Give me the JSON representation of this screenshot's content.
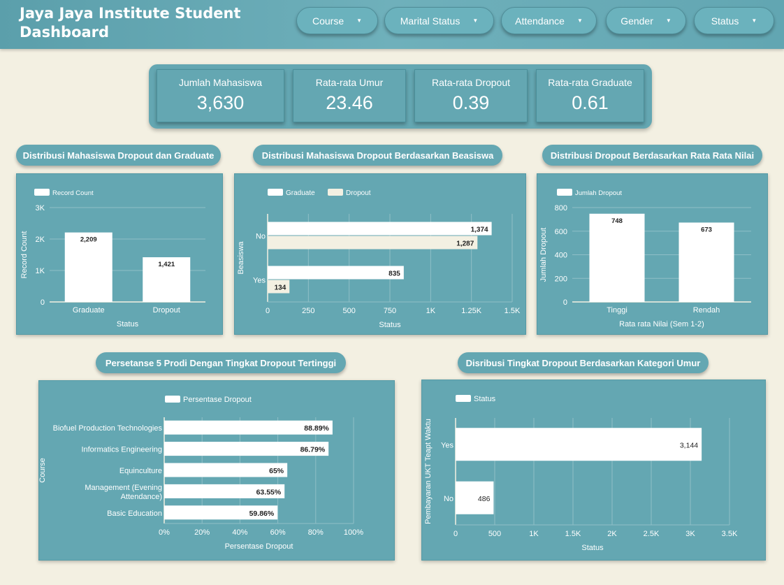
{
  "header": {
    "title": "Jaya Jaya Institute Student Dashboard"
  },
  "filters": [
    {
      "label": "Course"
    },
    {
      "label": "Marital Status"
    },
    {
      "label": "Attendance"
    },
    {
      "label": "Gender"
    },
    {
      "label": "Status"
    }
  ],
  "kpis": [
    {
      "label": "Jumlah Mahasiswa",
      "value": "3,630"
    },
    {
      "label": "Rata-rata Umur",
      "value": "23.46"
    },
    {
      "label": "Rata-rata Dropout",
      "value": "0.39"
    },
    {
      "label": "Rata-rata Graduate",
      "value": "0.61"
    }
  ],
  "colors": {
    "panel": "#64a7b2",
    "bar": "#ffffff",
    "bar_alt": "#f3f0e2",
    "background": "#f3f0e2"
  },
  "chart_data": [
    {
      "type": "bar",
      "title": "Distribusi Mahasiswa Dropout dan Graduate",
      "series": [
        {
          "name": "Record Count",
          "values": [
            2209,
            1421
          ]
        }
      ],
      "categories": [
        "Graduate",
        "Dropout"
      ],
      "data_labels": [
        "2,209",
        "1,421"
      ],
      "xlabel": "Status",
      "ylabel": "Record Count",
      "ylim": [
        0,
        3000
      ],
      "yticks": [
        0,
        1000,
        2000,
        3000
      ],
      "ytick_labels": [
        "0",
        "1K",
        "2K",
        "3K"
      ],
      "legend": "top-left"
    },
    {
      "type": "bar",
      "orientation": "horizontal",
      "title": "Distribusi Mahasiswa Dropout Berdasarkan Beasiswa",
      "categories": [
        "No",
        "Yes"
      ],
      "series": [
        {
          "name": "Graduate",
          "values": [
            1374,
            835
          ],
          "labels": [
            "1,374",
            "835"
          ]
        },
        {
          "name": "Dropout",
          "values": [
            1287,
            134
          ],
          "labels": [
            "1,287",
            "134"
          ]
        }
      ],
      "xlabel": "Status",
      "ylabel": "Beasiswa",
      "xlim": [
        0,
        1500
      ],
      "xticks": [
        0,
        250,
        500,
        750,
        1000,
        1250,
        1500
      ],
      "xtick_labels": [
        "0",
        "250",
        "500",
        "750",
        "1K",
        "1.25K",
        "1.5K"
      ],
      "legend": "top-left"
    },
    {
      "type": "bar",
      "title": "Distribusi Dropout Berdasarkan Rata Rata Nilai",
      "series": [
        {
          "name": "Jumlah Dropout",
          "values": [
            748,
            673
          ]
        }
      ],
      "categories": [
        "Tinggi",
        "Rendah"
      ],
      "data_labels": [
        "748",
        "673"
      ],
      "xlabel": "Rata rata Nilai (Sem 1-2)",
      "ylabel": "Jumlah Dropout",
      "ylim": [
        0,
        800
      ],
      "yticks": [
        0,
        200,
        400,
        600,
        800
      ],
      "ytick_labels": [
        "0",
        "200",
        "400",
        "600",
        "800"
      ],
      "legend": "top-left"
    },
    {
      "type": "bar",
      "orientation": "horizontal",
      "title": "Persetanse 5 Prodi Dengan Tingkat Dropout Tertinggi",
      "series": [
        {
          "name": "Persentase Dropout",
          "values": [
            88.89,
            86.79,
            65,
            63.55,
            59.86
          ]
        }
      ],
      "categories": [
        "Biofuel Production Technologies",
        "Informatics Engineering",
        "Equinculture",
        "Management (Evening Attendance)",
        "Basic Education"
      ],
      "category_lines": [
        [
          "Biofuel Production Technologies"
        ],
        [
          "Informatics Engineering"
        ],
        [
          "Equinculture"
        ],
        [
          "Management (Evening",
          "Attendance)"
        ],
        [
          "Basic Education"
        ]
      ],
      "data_labels": [
        "88.89%",
        "86.79%",
        "65%",
        "63.55%",
        "59.86%"
      ],
      "xlabel": "Persentase Dropout",
      "ylabel": "Course",
      "xlim": [
        0,
        100
      ],
      "xticks": [
        0,
        20,
        40,
        60,
        80,
        100
      ],
      "xtick_labels": [
        "0%",
        "20%",
        "40%",
        "60%",
        "80%",
        "100%"
      ],
      "legend": "top-left"
    },
    {
      "type": "bar",
      "orientation": "horizontal",
      "title": "Disribusi Tingkat Dropout Berdasarkan Kategori Umur",
      "series": [
        {
          "name": "Status",
          "values": [
            3144,
            486
          ]
        }
      ],
      "categories": [
        "Yes",
        "No"
      ],
      "data_labels": [
        "3,144",
        "486"
      ],
      "xlabel": "Status",
      "ylabel": "Pembayaran UKT Teapt Waktu",
      "xlim": [
        0,
        3500
      ],
      "xticks": [
        0,
        500,
        1000,
        1500,
        2000,
        2500,
        3000,
        3500
      ],
      "xtick_labels": [
        "0",
        "500",
        "1K",
        "1.5K",
        "2K",
        "2.5K",
        "3K",
        "3.5K"
      ],
      "legend": "top-left"
    }
  ]
}
